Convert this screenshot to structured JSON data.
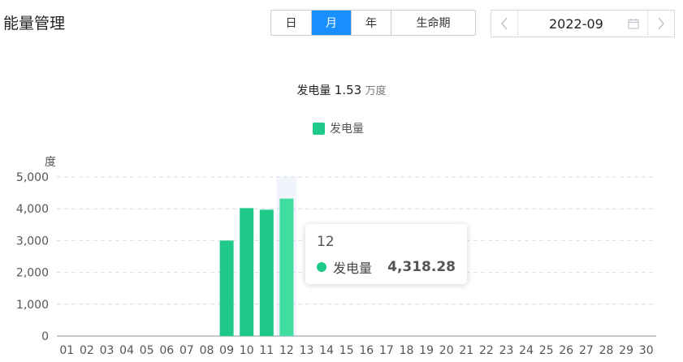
{
  "header": {
    "title": "能量管理",
    "period_tabs": [
      {
        "label": "日",
        "active": false
      },
      {
        "label": "月",
        "active": true
      },
      {
        "label": "年",
        "active": false
      },
      {
        "label": "生命期",
        "active": false
      }
    ],
    "date_value": "2022-09",
    "prev_icon": "chevron-left-icon",
    "next_icon": "chevron-right-icon",
    "calendar_icon": "calendar-icon"
  },
  "summary": {
    "label": "发电量",
    "value": "1.53",
    "unit": "万度"
  },
  "colors": {
    "accent": "#1890ff",
    "series": "#1ec98a",
    "highlight": "#3fdda0"
  },
  "tooltip": {
    "title": "12",
    "series_name": "发电量",
    "value": "4,318.28"
  },
  "chart_data": {
    "type": "bar",
    "ylabel": "度",
    "legend": [
      "发电量"
    ],
    "legend_position": "top-center",
    "ylim": [
      0,
      5000
    ],
    "yticks": [
      "0",
      "1,000",
      "2,000",
      "3,000",
      "4,000",
      "5,000"
    ],
    "grid": true,
    "categories": [
      "01",
      "02",
      "03",
      "04",
      "05",
      "06",
      "07",
      "08",
      "09",
      "10",
      "11",
      "12",
      "13",
      "14",
      "15",
      "16",
      "17",
      "18",
      "19",
      "20",
      "21",
      "22",
      "23",
      "24",
      "25",
      "26",
      "27",
      "28",
      "29",
      "30"
    ],
    "series": [
      {
        "name": "发电量",
        "values": [
          0,
          0,
          0,
          0,
          0,
          0,
          0,
          0,
          3000,
          4020,
          3970,
          4318.28,
          0,
          0,
          0,
          0,
          0,
          0,
          0,
          0,
          0,
          0,
          0,
          0,
          0,
          0,
          0,
          0,
          0,
          0
        ]
      }
    ],
    "highlight_category": "12"
  }
}
